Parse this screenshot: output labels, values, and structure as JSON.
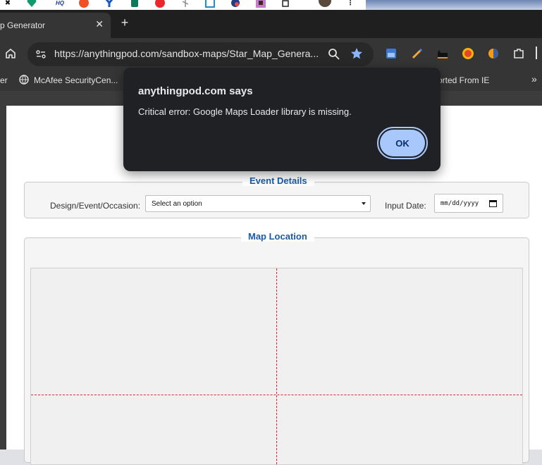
{
  "browser": {
    "tab": {
      "title": "p Generator",
      "close_glyph": "✕"
    },
    "new_tab_glyph": "+",
    "address_bar": {
      "url": "https://anythingpod.com/sandbox-maps/Star_Map_Genera..."
    },
    "bookmarks": {
      "items": [
        {
          "label": "er"
        },
        {
          "label": "McAfee SecurityCen..."
        },
        {
          "label": "orted From IE"
        }
      ],
      "more_glyph": "»"
    },
    "top_strip_icons": [
      "x-icon",
      "heart-icon",
      "hq-icon",
      "mi-icon",
      "y-icon",
      "cup-icon",
      "g-icon",
      "leaf-icon",
      "box-icon",
      "s-icon",
      "grid-icon",
      "puzzle-icon",
      "avatar-icon",
      "more-icon"
    ],
    "top_strip_texts": {
      "hq": "HQ",
      "more": "⋮"
    },
    "extensions": [
      "image-icon",
      "pen-icon",
      "cat-icon",
      "mi-icon",
      "orange-icon",
      "puzzle-icon"
    ]
  },
  "page": {
    "event_details": {
      "legend": "Event Details",
      "design_label": "Design/Event/Occasion:",
      "design_select_value": "Select an option",
      "date_label": "Input Date:",
      "date_value": "mm/dd/yyyy"
    },
    "map_location": {
      "legend": "Map Location"
    }
  },
  "dialog": {
    "title": "anythingpod.com says",
    "message": "Critical error: Google Maps Loader library is missing.",
    "ok_label": "OK"
  },
  "colors": {
    "accent_blue": "#1c5aa6",
    "dialog_button": "#a8c7fa",
    "crosshair": "#e0262e"
  }
}
